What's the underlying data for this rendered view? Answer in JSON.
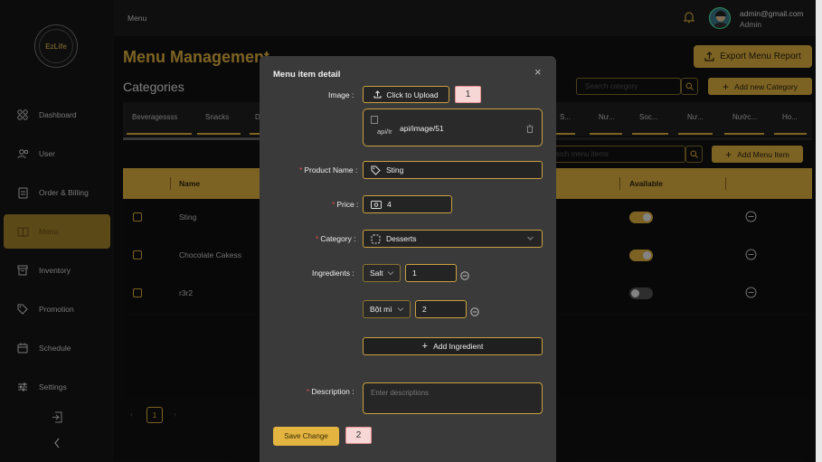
{
  "sidebar": {
    "logo_text": "EzLife",
    "items": [
      {
        "label": "Dashboard",
        "icon": "dashboard-icon"
      },
      {
        "label": "User",
        "icon": "users-icon"
      },
      {
        "label": "Order & Billing",
        "icon": "receipt-icon"
      },
      {
        "label": "Menu",
        "icon": "book-icon",
        "active": true
      },
      {
        "label": "Inventory",
        "icon": "archive-icon"
      },
      {
        "label": "Promotion",
        "icon": "tag-icon"
      },
      {
        "label": "Schedule",
        "icon": "calendar-icon"
      },
      {
        "label": "Settings",
        "icon": "sliders-icon"
      }
    ]
  },
  "topbar": {
    "breadcrumb": "Menu",
    "user_email": "admin@gmail.com",
    "user_role": "Admin"
  },
  "main": {
    "title": "Menu Management",
    "export_label": "Export Menu Report",
    "categories_title": "Categories",
    "search_category_placeholder": "Search category",
    "add_category_label": "Add new Category",
    "tabs": [
      "Beveragessss",
      "Snacks",
      "D",
      "S...",
      "Nư...",
      "Soc...",
      "Nư...",
      "Nước...",
      "Ho..."
    ],
    "search_items_placeholder": "Search menu items",
    "add_item_label": "Add Menu Item",
    "columns": {
      "name": "Name",
      "available": "Available"
    },
    "rows": [
      {
        "name": "Sting",
        "available": true
      },
      {
        "name": "Chocolate Cakess",
        "available": true
      },
      {
        "name": "r3r2",
        "available": false
      }
    ],
    "pagination": {
      "current": "1",
      "prev": "‹",
      "next": "›"
    }
  },
  "modal": {
    "title": "Menu item detail",
    "close": "×",
    "image_label": "Image",
    "upload_label": "Click to Upload",
    "badge_1": "1",
    "badge_2": "2",
    "file_alt": "api/Ir",
    "file_name": "api/image/51",
    "product_name_label": "Product Name",
    "product_name_value": "Sting",
    "price_label": "Price",
    "price_value": "4",
    "category_label": "Category",
    "category_value": "Desserts",
    "ingredients_label": "Ingredients",
    "ingredients": [
      {
        "name": "Salt",
        "qty": "1"
      },
      {
        "name": "Bột mì",
        "qty": "2"
      }
    ],
    "add_ingredient_label": "Add Ingredient",
    "description_label": "Description",
    "description_placeholder": "Enter descriptions",
    "save_label": "Save Change"
  },
  "colors": {
    "accent": "#e3b440",
    "background": "#121212",
    "modal_bg": "#3a3a3a",
    "toggle_on": "#e3b440",
    "toggle_off": "#555555"
  }
}
